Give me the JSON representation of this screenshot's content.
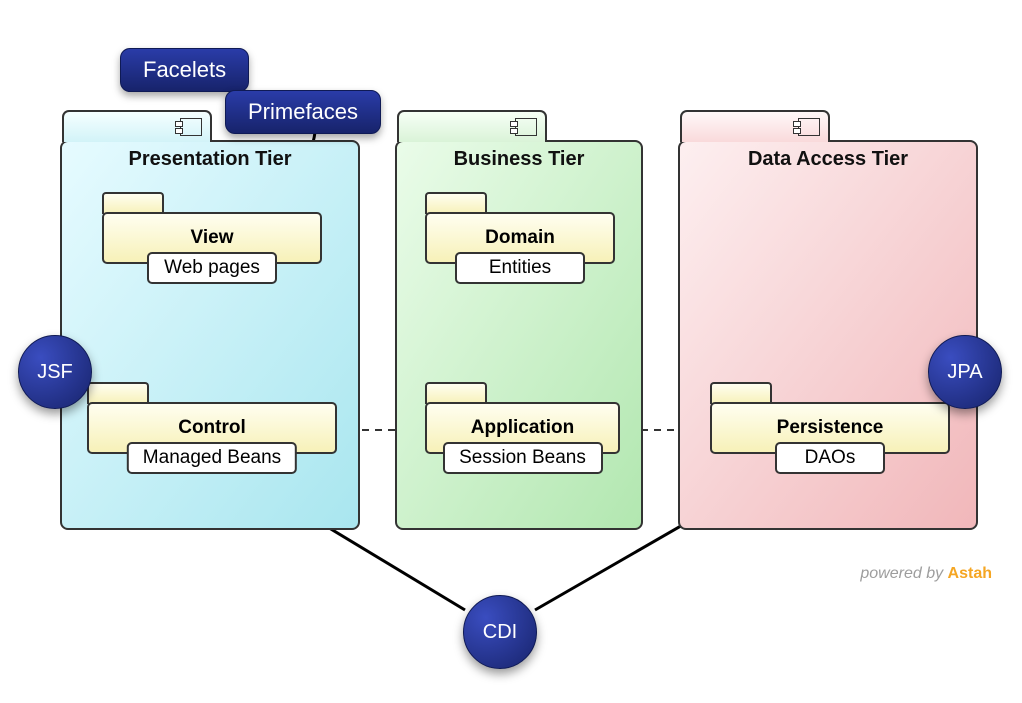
{
  "tiers": {
    "presentation": {
      "title": "Presentation Tier"
    },
    "business": {
      "title": "Business Tier"
    },
    "data_access": {
      "title": "Data Access Tier"
    }
  },
  "packages": {
    "view": {
      "name": "View",
      "stereotype": "Web pages"
    },
    "control": {
      "name": "Control",
      "stereotype": "Managed Beans"
    },
    "domain": {
      "name": "Domain",
      "stereotype": "Entities"
    },
    "application": {
      "name": "Application",
      "stereotype": "Session Beans"
    },
    "persistence": {
      "name": "Persistence",
      "stereotype": "DAOs"
    }
  },
  "annotations": {
    "facelets": "Facelets",
    "primefaces": "Primefaces",
    "jsf": "JSF",
    "cdi": "CDI",
    "jpa": "JPA"
  },
  "footer": {
    "prefix": "powered by ",
    "brand": "Astah"
  },
  "colors": {
    "badge_blue": "#2a3ca8"
  }
}
